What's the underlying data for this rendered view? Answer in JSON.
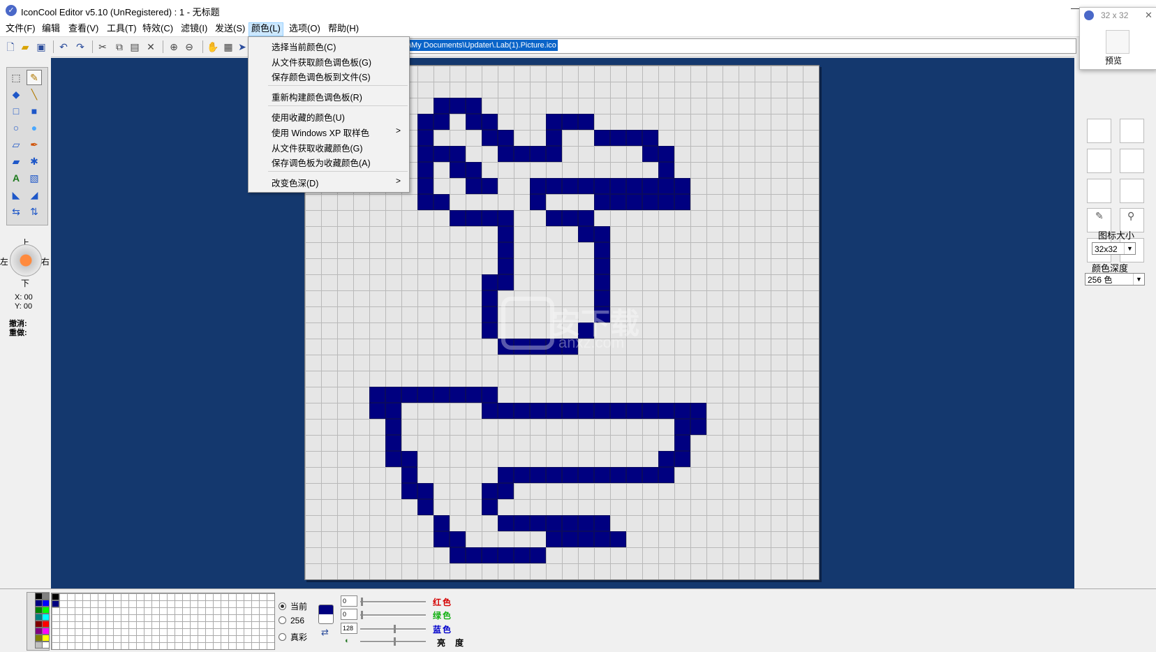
{
  "window": {
    "title": "IconCool Editor v5.10 (UnRegistered) : 1 - 无标题"
  },
  "menus": [
    "文件(F)",
    "编辑",
    "查看(V)",
    "工具(T)",
    "特效(C)",
    "滤镜(I)",
    "发送(S)",
    "颜色(L)",
    "选项(O)",
    "帮助(H)"
  ],
  "active_menu": "颜色(L)",
  "dropdown": {
    "items": [
      "选择当前颜色(C)",
      "从文件获取颜色调色板(G)",
      "保存颜色调色板到文件(S)",
      "重新构建颜色调色板(R)",
      "使用收藏的颜色(U)",
      "使用 Windows XP 取样色",
      "从文件获取收藏颜色(G)",
      "保存调色板为收藏颜色(A)",
      "改变色深(D)"
    ],
    "submenu_arrow": ">"
  },
  "path": "\\My Documents\\Updater\\.Lab(1).Picture.ico",
  "nav": {
    "up": "上",
    "down": "下",
    "left": "左",
    "right": "右"
  },
  "coords": {
    "x": "X: 00",
    "y": "Y: 00"
  },
  "undo_label": "撤消:",
  "redo_label": "重做:",
  "preview": {
    "size_label": "32 x 32",
    "close": "✕",
    "caption": "预览"
  },
  "right_panel": {
    "icon_size_label": "图标大小",
    "icon_size_value": "32x32",
    "color_depth_label": "颜色深度",
    "color_depth_value": "256 色"
  },
  "palette_mode": {
    "options": [
      "当前",
      "256",
      "真彩"
    ],
    "selected": "当前"
  },
  "rgb": {
    "red": {
      "label": "红色",
      "value": "0",
      "color": "#d40000"
    },
    "green": {
      "label": "绿色",
      "value": "0",
      "color": "#12b012"
    },
    "blue": {
      "label": "蓝色",
      "value": "128",
      "color": "#0000cc"
    },
    "brightness": {
      "label": "亮度"
    }
  },
  "pixel_color": "#000080",
  "watermark": {
    "text": "安下载",
    "sub": "anxz.com"
  },
  "pixels": [
    [
      8,
      2
    ],
    [
      9,
      2
    ],
    [
      10,
      2
    ],
    [
      7,
      3
    ],
    [
      8,
      3
    ],
    [
      10,
      3
    ],
    [
      11,
      3
    ],
    [
      15,
      3
    ],
    [
      16,
      3
    ],
    [
      17,
      3
    ],
    [
      7,
      4
    ],
    [
      11,
      4
    ],
    [
      12,
      4
    ],
    [
      15,
      4
    ],
    [
      18,
      4
    ],
    [
      19,
      4
    ],
    [
      20,
      4
    ],
    [
      21,
      4
    ],
    [
      7,
      5
    ],
    [
      8,
      5
    ],
    [
      9,
      5
    ],
    [
      12,
      5
    ],
    [
      13,
      5
    ],
    [
      14,
      5
    ],
    [
      15,
      5
    ],
    [
      21,
      5
    ],
    [
      22,
      5
    ],
    [
      7,
      6
    ],
    [
      9,
      6
    ],
    [
      10,
      6
    ],
    [
      22,
      6
    ],
    [
      7,
      7
    ],
    [
      10,
      7
    ],
    [
      11,
      7
    ],
    [
      14,
      7
    ],
    [
      15,
      7
    ],
    [
      16,
      7
    ],
    [
      17,
      7
    ],
    [
      18,
      7
    ],
    [
      19,
      7
    ],
    [
      20,
      7
    ],
    [
      21,
      7
    ],
    [
      22,
      7
    ],
    [
      23,
      7
    ],
    [
      7,
      8
    ],
    [
      8,
      8
    ],
    [
      14,
      8
    ],
    [
      18,
      8
    ],
    [
      19,
      8
    ],
    [
      20,
      8
    ],
    [
      21,
      8
    ],
    [
      22,
      8
    ],
    [
      23,
      8
    ],
    [
      9,
      9
    ],
    [
      10,
      9
    ],
    [
      11,
      9
    ],
    [
      12,
      9
    ],
    [
      15,
      9
    ],
    [
      16,
      9
    ],
    [
      17,
      9
    ],
    [
      12,
      10
    ],
    [
      17,
      10
    ],
    [
      18,
      10
    ],
    [
      12,
      11
    ],
    [
      18,
      11
    ],
    [
      12,
      12
    ],
    [
      18,
      12
    ],
    [
      11,
      13
    ],
    [
      12,
      13
    ],
    [
      18,
      13
    ],
    [
      11,
      14
    ],
    [
      18,
      14
    ],
    [
      11,
      15
    ],
    [
      18,
      15
    ],
    [
      11,
      16
    ],
    [
      17,
      16
    ],
    [
      12,
      17
    ],
    [
      13,
      17
    ],
    [
      14,
      17
    ],
    [
      15,
      17
    ],
    [
      16,
      17
    ],
    [
      4,
      20
    ],
    [
      5,
      20
    ],
    [
      6,
      20
    ],
    [
      7,
      20
    ],
    [
      8,
      20
    ],
    [
      9,
      20
    ],
    [
      10,
      20
    ],
    [
      11,
      20
    ],
    [
      4,
      21
    ],
    [
      5,
      21
    ],
    [
      11,
      21
    ],
    [
      12,
      21
    ],
    [
      13,
      21
    ],
    [
      14,
      21
    ],
    [
      15,
      21
    ],
    [
      16,
      21
    ],
    [
      17,
      21
    ],
    [
      18,
      21
    ],
    [
      19,
      21
    ],
    [
      20,
      21
    ],
    [
      21,
      21
    ],
    [
      22,
      21
    ],
    [
      23,
      21
    ],
    [
      24,
      21
    ],
    [
      5,
      22
    ],
    [
      23,
      22
    ],
    [
      24,
      22
    ],
    [
      5,
      23
    ],
    [
      23,
      23
    ],
    [
      5,
      24
    ],
    [
      6,
      24
    ],
    [
      22,
      24
    ],
    [
      23,
      24
    ],
    [
      6,
      25
    ],
    [
      12,
      25
    ],
    [
      13,
      25
    ],
    [
      14,
      25
    ],
    [
      15,
      25
    ],
    [
      16,
      25
    ],
    [
      17,
      25
    ],
    [
      18,
      25
    ],
    [
      19,
      25
    ],
    [
      20,
      25
    ],
    [
      21,
      25
    ],
    [
      22,
      25
    ],
    [
      6,
      26
    ],
    [
      7,
      26
    ],
    [
      11,
      26
    ],
    [
      12,
      26
    ],
    [
      7,
      27
    ],
    [
      11,
      27
    ],
    [
      8,
      28
    ],
    [
      12,
      28
    ],
    [
      13,
      28
    ],
    [
      14,
      28
    ],
    [
      15,
      28
    ],
    [
      16,
      28
    ],
    [
      17,
      28
    ],
    [
      18,
      28
    ],
    [
      8,
      29
    ],
    [
      9,
      29
    ],
    [
      15,
      29
    ],
    [
      16,
      29
    ],
    [
      17,
      29
    ],
    [
      18,
      29
    ],
    [
      19,
      29
    ],
    [
      9,
      30
    ],
    [
      10,
      30
    ],
    [
      11,
      30
    ],
    [
      12,
      30
    ],
    [
      13,
      30
    ],
    [
      14,
      30
    ]
  ],
  "palette_colors": [
    "#000000",
    "#808080",
    "#000080",
    "#0000ff",
    "#008000",
    "#00ff00",
    "#008080",
    "#00ffff",
    "#800000",
    "#ff0000",
    "#800080",
    "#ff00ff",
    "#808000",
    "#ffff00",
    "#c0c0c0",
    "#ffffff"
  ]
}
